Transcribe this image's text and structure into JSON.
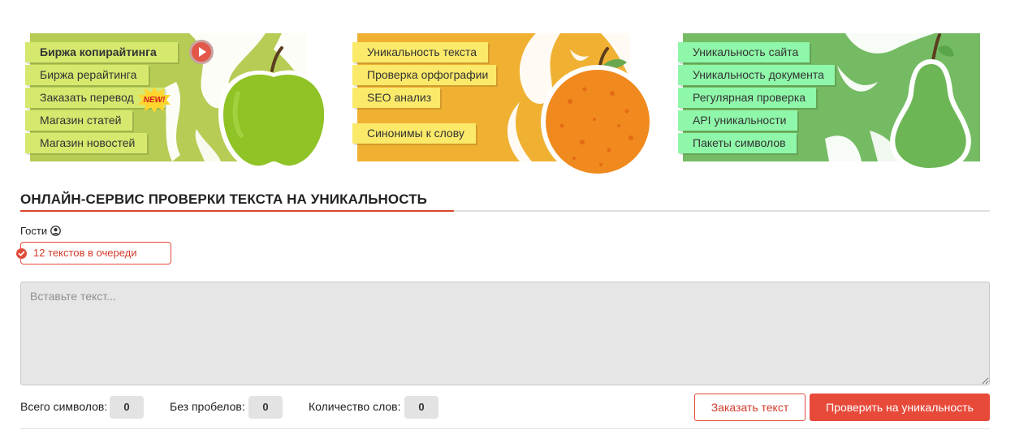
{
  "banners": [
    {
      "theme": "apple",
      "colors": {
        "background": "#b6cc55",
        "menu": "#d6e86e",
        "fruit": "#8fc326"
      },
      "items": [
        {
          "label": "Биржа копирайтинга",
          "bold": true
        },
        {
          "label": "Биржа рерайтинга"
        },
        {
          "label": "Заказать перевод"
        },
        {
          "label": "Магазин статей"
        },
        {
          "label": "Магазин новостей"
        }
      ],
      "badge": "NEW!"
    },
    {
      "theme": "orange",
      "colors": {
        "background": "#f0b133",
        "menu": "#fbe96a",
        "fruit": "#f08a1e"
      },
      "items": [
        {
          "label": "Уникальность текста"
        },
        {
          "label": "Проверка орфографии"
        },
        {
          "label": "SEO анализ"
        },
        {
          "label": "Синонимы к слову"
        }
      ]
    },
    {
      "theme": "pear",
      "colors": {
        "background": "#74bb63",
        "menu": "#8ff7a9",
        "fruit": "#6db656"
      },
      "items": [
        {
          "label": "Уникальность сайта"
        },
        {
          "label": "Уникальность документа"
        },
        {
          "label": "Регулярная проверка"
        },
        {
          "label": "API уникальности"
        },
        {
          "label": "Пакеты символов"
        }
      ]
    }
  ],
  "title": "ОНЛАЙН-СЕРВИС ПРОВЕРКИ ТЕКСТА НА УНИКАЛЬНОСТЬ",
  "user": {
    "label": "Гости",
    "icon": "user-circle-icon"
  },
  "queue_status": "12 текстов в очереди",
  "text_input": {
    "placeholder": "Вставьте текст...",
    "value": ""
  },
  "stats": {
    "total_label": "Всего символов:",
    "total_value": "0",
    "nospace_label": "Без пробелов:",
    "nospace_value": "0",
    "words_label": "Количество слов:",
    "words_value": "0"
  },
  "buttons": {
    "order": "Заказать текст",
    "check": "Проверить на уникальность"
  },
  "accent_color": "#e84a3a"
}
